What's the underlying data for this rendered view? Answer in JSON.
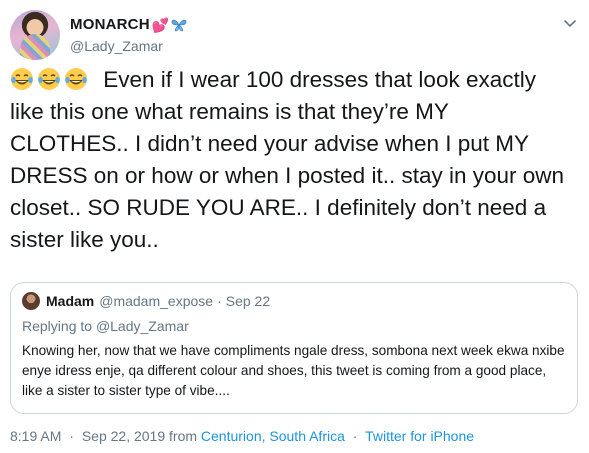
{
  "author": {
    "display_name": "MONARCH",
    "handle": "@Lady_Zamar",
    "name_emojis": [
      "two-hearts-emoji",
      "butterfly-emoji"
    ]
  },
  "tweet": {
    "leading_emojis": [
      "face-with-tears-of-joy-emoji",
      "face-with-tears-of-joy-emoji",
      "face-with-tears-of-joy-emoji"
    ],
    "text": "Even if I wear 100 dresses that look exactly like this one what remains is that they’re MY CLOTHES.. I didn’t need your advise when I put MY DRESS on or how or when I posted it.. stay in your own closet.. SO RUDE YOU ARE.. I definitely don’t need a sister like you.."
  },
  "quoted": {
    "name": "Madam",
    "handle": "@madam_expose",
    "separator": "·",
    "date": "Sep 22",
    "replying_prefix": "Replying to",
    "replying_handle": "@Lady_Zamar",
    "text": "Knowing her, now that we have compliments ngale dress, sombona next week ekwa nxibe enye idress enje, qa different colour and shoes, this tweet is coming from a good place, like a sister to sister type of vibe...."
  },
  "meta": {
    "time": "8:19 AM",
    "separator": "·",
    "date": "Sep 22, 2019",
    "from_prefix": "from",
    "location": "Centurion, South Africa",
    "source": "Twitter for iPhone"
  },
  "colors": {
    "text": "#14171a",
    "secondary": "#657786",
    "link": "#1b95e0",
    "border": "#ccd6dd"
  }
}
